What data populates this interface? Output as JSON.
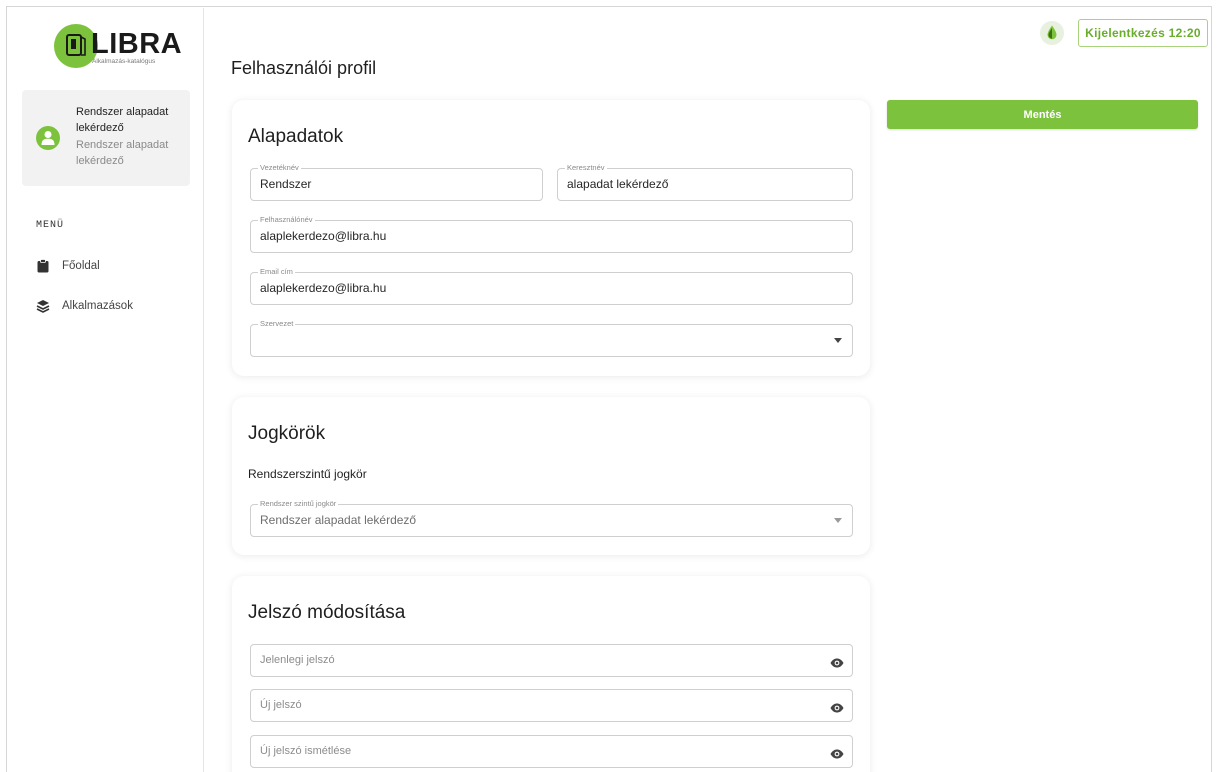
{
  "brand": {
    "name": "LIBRA",
    "subtitle": "Alkalmazás-katalógus",
    "accent": "#7cc23d"
  },
  "user": {
    "name": "Rendszer alapadat lekérdező",
    "role": "Rendszer alapadat lekérdező",
    "icon": "user-icon"
  },
  "menu": {
    "label": "MENÜ",
    "items": [
      {
        "label": "Főoldal",
        "icon": "clipboard-icon"
      },
      {
        "label": "Alkalmazások",
        "icon": "layers-icon"
      }
    ]
  },
  "header": {
    "theme_icon": "drop-icon",
    "logout_label": "Kijelentkezés 12:20"
  },
  "page": {
    "title": "Felhasználói profil",
    "save_label": "Mentés"
  },
  "basic": {
    "title": "Alapadatok",
    "last_name": {
      "label": "Vezetéknév",
      "value": "Rendszer"
    },
    "first_name": {
      "label": "Keresztnév",
      "value": "alapadat lekérdező"
    },
    "username": {
      "label": "Felhasználónév",
      "value": "alaplekerdezo@libra.hu"
    },
    "email": {
      "label": "Email cím",
      "value": "alaplekerdezo@libra.hu"
    },
    "organization": {
      "label": "Szervezet",
      "value": ""
    }
  },
  "roles": {
    "title": "Jogkörök",
    "subtitle": "Rendszerszintű jogkör",
    "system_role": {
      "label": "Rendszer szintű jogkör",
      "value": "Rendszer alapadat lekérdező"
    }
  },
  "password": {
    "title": "Jelszó módosítása",
    "current_placeholder": "Jelenlegi jelszó",
    "new_placeholder": "Új jelszó",
    "repeat_placeholder": "Új jelszó ismétlése"
  }
}
